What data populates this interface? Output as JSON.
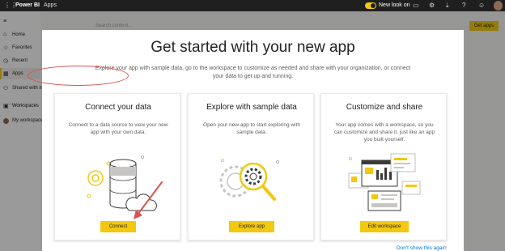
{
  "topbar": {
    "app_name": "Power BI",
    "breadcrumb": "Apps",
    "new_look_label": "New look on",
    "icons": [
      "grid-icon",
      "comment-icon",
      "gear-icon",
      "download-icon",
      "help-icon",
      "smiley-icon"
    ]
  },
  "leftnav": {
    "items": [
      {
        "label": "Home",
        "icon": "home-icon"
      },
      {
        "label": "Favorites",
        "icon": "star-icon"
      },
      {
        "label": "Recent",
        "icon": "clock-icon"
      },
      {
        "label": "Apps",
        "icon": "apps-icon"
      },
      {
        "label": "Shared with me",
        "icon": "shared-icon"
      },
      {
        "label": "Workspaces",
        "icon": "workspaces-icon"
      },
      {
        "label": "My workspace",
        "icon": "avatar"
      }
    ]
  },
  "background": {
    "search_placeholder": "Search content...",
    "get_apps_label": "Get apps"
  },
  "modal": {
    "title": "Get started with your new app",
    "subtitle": "Explore your app with sample data, go to the workspace to customize as needed and share with your organization, or connect your data to get up and running.",
    "cards": [
      {
        "title": "Connect your data",
        "description": "Connect to a data source to view your new app with your own data.",
        "button": "Connect"
      },
      {
        "title": "Explore with sample data",
        "description": "Open your new app to start exploring with sample data.",
        "button": "Explore app"
      },
      {
        "title": "Customize and share",
        "description": "Your app comes with a workspace, so you can customize and share it, just like an app you built yourself.",
        "button": "Edit workspace"
      }
    ],
    "dont_show": "Don't show this again"
  },
  "colors": {
    "accent": "#f2c811",
    "topbar": "#1f1f1f",
    "annotation": "#d9534f",
    "link": "#0078d4"
  }
}
